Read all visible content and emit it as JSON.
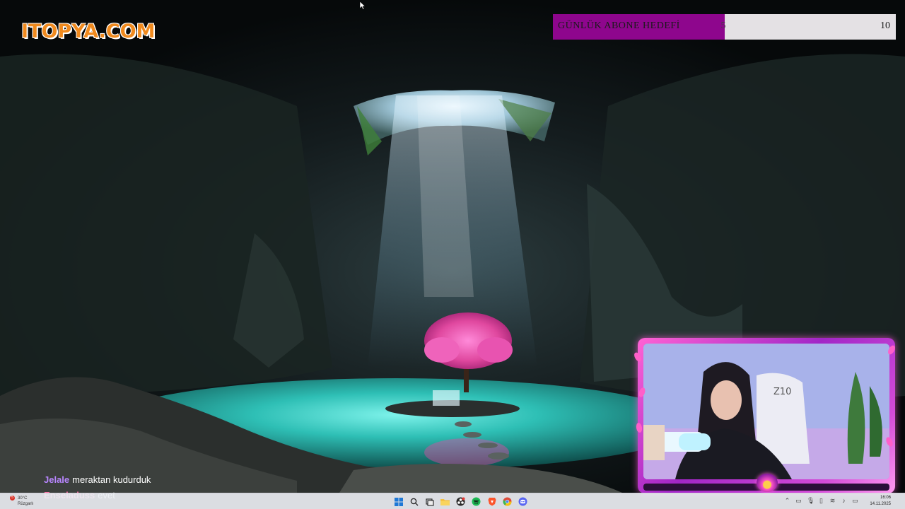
{
  "logo": {
    "text": "ITOPYA.COM"
  },
  "sub_goal": {
    "label": "GÜNLÜK ABONE HEDEFİ",
    "current": 5,
    "target": 10,
    "progress": 0.5,
    "fill_color": "#8e068d",
    "track_color": "#e4e1e4"
  },
  "chat": {
    "messages": [
      {
        "user": "Jelale",
        "user_color": "#b886ff",
        "text": "meraktan kudurduk"
      },
      {
        "user": "Enseladuss",
        "user_color": "#ff6fa5",
        "text": "evet"
      }
    ]
  },
  "webcam": {
    "frame_colors": [
      "#ff63d4",
      "#a226c7"
    ]
  },
  "taskbar": {
    "weather": {
      "badge": "5",
      "temp": "30°C",
      "condition": "Rüzgarlı"
    },
    "apps": [
      {
        "name": "windows-start-icon"
      },
      {
        "name": "search-icon"
      },
      {
        "name": "task-view-icon"
      },
      {
        "name": "file-explorer-icon"
      },
      {
        "name": "obs-icon"
      },
      {
        "name": "spotify-icon"
      },
      {
        "name": "brave-browser-icon"
      },
      {
        "name": "chrome-icon"
      },
      {
        "name": "discord-icon"
      }
    ],
    "tray": [
      {
        "name": "chevron-up-icon",
        "glyph": "⌃"
      },
      {
        "name": "network-icon",
        "glyph": "▭"
      },
      {
        "name": "microphone-icon",
        "glyph": "🎙"
      },
      {
        "name": "display-icon",
        "glyph": "▯"
      },
      {
        "name": "wifi-icon",
        "glyph": "≋"
      },
      {
        "name": "volume-icon",
        "glyph": "♪"
      },
      {
        "name": "battery-icon",
        "glyph": "▭"
      }
    ],
    "clock": {
      "time": "16:06",
      "date": "14.11.2025"
    }
  }
}
